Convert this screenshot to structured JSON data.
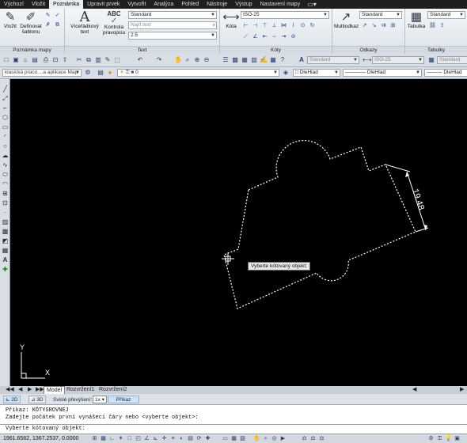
{
  "menu": {
    "items": [
      "Výchozí",
      "Vložit",
      "Poznámka",
      "Upravit prvek",
      "Vytvořit",
      "Analýza",
      "Pohled",
      "Nástroje",
      "Výstup",
      "Nastavení mapy"
    ],
    "active_index": 2
  },
  "ribbon": {
    "poznamka_mapy": {
      "title": "Poznámka mapy",
      "vlozit": "Vložit",
      "definovat": "Definovat šablonu"
    },
    "text": {
      "title": "Text",
      "viceradkovy": "Víceřádkový text",
      "kontrola": "Kontrola pravopisu",
      "style_value": "Standard",
      "find_placeholder": "Najít text",
      "height_value": "2.5"
    },
    "koty": {
      "title": "Kóty",
      "kota": "Kóta",
      "style_value": "ISO-25"
    },
    "odkazy": {
      "title": "Odkazy",
      "multiodkaz": "Multiodkaz",
      "style_value": "Standard"
    },
    "tabulky": {
      "title": "Tabulky",
      "tabulka": "Tabulka",
      "style_value": "Standard"
    }
  },
  "toolbar1": {
    "text_style": "Standard",
    "dim_style": "ISO-25",
    "table_style": "Standard"
  },
  "toolbar2": {
    "workspace": "klasická praco....a aplikace Map",
    "layer": "0",
    "color": "DleHlad",
    "linetype": "DleHlad",
    "lineweight": "DleHlad"
  },
  "canvas": {
    "dimension_text": "19.48",
    "tooltip": "Vyberte kótovaný objekt:",
    "ucs_x": "X",
    "ucs_y": "Y"
  },
  "layout_tabs": [
    "Model",
    "Rozvržení1",
    "Rozvržení2"
  ],
  "status": {
    "btn_2d": "2D",
    "btn_3d": "3D",
    "scale_label": "Svislé převýšení:",
    "scale_value": "1x",
    "prikaz": "Příkaz"
  },
  "command": {
    "line1": "Příkaz: KÓTYSROVNEJ",
    "line2": "Zadejte počátek první vynášecí čáry nebo <vyberte objekt>:",
    "prompt": "Vyberte kótovaný objekt:"
  },
  "footer": {
    "coords": "1961.6582, 1367.2537, 0.0000"
  }
}
